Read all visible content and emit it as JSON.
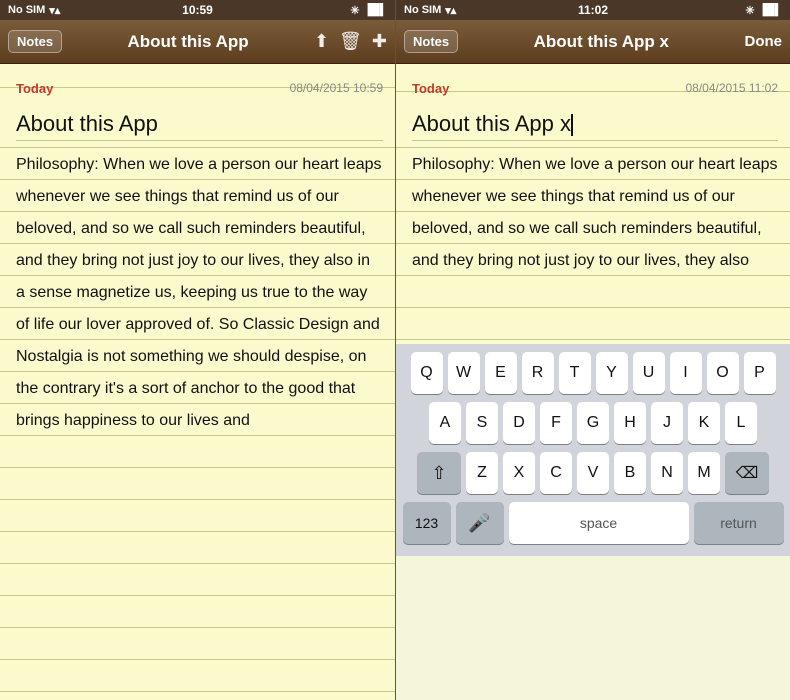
{
  "screen1": {
    "status": {
      "carrier": "No SIM",
      "wifi": "WiFi",
      "time": "10:59",
      "bluetooth": "BT",
      "battery": "Battery"
    },
    "nav": {
      "back_label": "Notes",
      "title": "About this App",
      "share_icon": "share",
      "trash_icon": "trash",
      "add_icon": "add"
    },
    "note": {
      "today_label": "Today",
      "date": "08/04/2015 10:59",
      "title": "About this App",
      "body": "Philosophy: When we love a person our heart leaps whenever we see things that remind us of our beloved, and so we call such reminders beautiful, and they bring not just joy to our lives, they also in a sense magnetize us, keeping us true to the way of life our lover approved of. So Classic Design and Nostalgia is not something we should despise, on the contrary it's a sort of anchor to the good that brings happiness to our lives and"
    }
  },
  "screen2": {
    "status": {
      "carrier": "No SIM",
      "wifi": "WiFi",
      "time": "11:02",
      "bluetooth": "BT",
      "battery": "Battery"
    },
    "nav": {
      "back_label": "Notes",
      "title": "About this App x",
      "done_label": "Done"
    },
    "note": {
      "today_label": "Today",
      "date": "08/04/2015 11:02",
      "title": "About this App x",
      "body": "Philosophy: When we love a person our heart leaps whenever we see things that remind us of our beloved, and so we call such reminders beautiful, and they bring not just joy to our lives, they also"
    },
    "keyboard": {
      "row1": [
        "Q",
        "W",
        "E",
        "R",
        "T",
        "Y",
        "U",
        "I",
        "O",
        "P"
      ],
      "row2": [
        "A",
        "S",
        "D",
        "F",
        "G",
        "H",
        "J",
        "K",
        "L"
      ],
      "row3": [
        "Z",
        "X",
        "C",
        "V",
        "B",
        "N",
        "M"
      ],
      "space_label": "space",
      "return_label": "return",
      "num_label": "123",
      "delete_symbol": "⌫",
      "shift_symbol": "⇧",
      "mic_symbol": "🎤"
    }
  }
}
